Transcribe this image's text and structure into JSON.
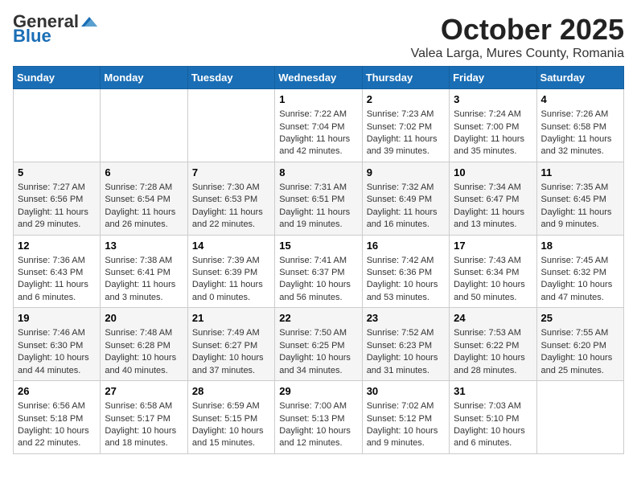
{
  "header": {
    "logo_general": "General",
    "logo_blue": "Blue",
    "month_title": "October 2025",
    "subtitle": "Valea Larga, Mures County, Romania"
  },
  "weekdays": [
    "Sunday",
    "Monday",
    "Tuesday",
    "Wednesday",
    "Thursday",
    "Friday",
    "Saturday"
  ],
  "weeks": [
    [
      {
        "day": "",
        "info": ""
      },
      {
        "day": "",
        "info": ""
      },
      {
        "day": "",
        "info": ""
      },
      {
        "day": "1",
        "info": "Sunrise: 7:22 AM\nSunset: 7:04 PM\nDaylight: 11 hours and 42 minutes."
      },
      {
        "day": "2",
        "info": "Sunrise: 7:23 AM\nSunset: 7:02 PM\nDaylight: 11 hours and 39 minutes."
      },
      {
        "day": "3",
        "info": "Sunrise: 7:24 AM\nSunset: 7:00 PM\nDaylight: 11 hours and 35 minutes."
      },
      {
        "day": "4",
        "info": "Sunrise: 7:26 AM\nSunset: 6:58 PM\nDaylight: 11 hours and 32 minutes."
      }
    ],
    [
      {
        "day": "5",
        "info": "Sunrise: 7:27 AM\nSunset: 6:56 PM\nDaylight: 11 hours and 29 minutes."
      },
      {
        "day": "6",
        "info": "Sunrise: 7:28 AM\nSunset: 6:54 PM\nDaylight: 11 hours and 26 minutes."
      },
      {
        "day": "7",
        "info": "Sunrise: 7:30 AM\nSunset: 6:53 PM\nDaylight: 11 hours and 22 minutes."
      },
      {
        "day": "8",
        "info": "Sunrise: 7:31 AM\nSunset: 6:51 PM\nDaylight: 11 hours and 19 minutes."
      },
      {
        "day": "9",
        "info": "Sunrise: 7:32 AM\nSunset: 6:49 PM\nDaylight: 11 hours and 16 minutes."
      },
      {
        "day": "10",
        "info": "Sunrise: 7:34 AM\nSunset: 6:47 PM\nDaylight: 11 hours and 13 minutes."
      },
      {
        "day": "11",
        "info": "Sunrise: 7:35 AM\nSunset: 6:45 PM\nDaylight: 11 hours and 9 minutes."
      }
    ],
    [
      {
        "day": "12",
        "info": "Sunrise: 7:36 AM\nSunset: 6:43 PM\nDaylight: 11 hours and 6 minutes."
      },
      {
        "day": "13",
        "info": "Sunrise: 7:38 AM\nSunset: 6:41 PM\nDaylight: 11 hours and 3 minutes."
      },
      {
        "day": "14",
        "info": "Sunrise: 7:39 AM\nSunset: 6:39 PM\nDaylight: 11 hours and 0 minutes."
      },
      {
        "day": "15",
        "info": "Sunrise: 7:41 AM\nSunset: 6:37 PM\nDaylight: 10 hours and 56 minutes."
      },
      {
        "day": "16",
        "info": "Sunrise: 7:42 AM\nSunset: 6:36 PM\nDaylight: 10 hours and 53 minutes."
      },
      {
        "day": "17",
        "info": "Sunrise: 7:43 AM\nSunset: 6:34 PM\nDaylight: 10 hours and 50 minutes."
      },
      {
        "day": "18",
        "info": "Sunrise: 7:45 AM\nSunset: 6:32 PM\nDaylight: 10 hours and 47 minutes."
      }
    ],
    [
      {
        "day": "19",
        "info": "Sunrise: 7:46 AM\nSunset: 6:30 PM\nDaylight: 10 hours and 44 minutes."
      },
      {
        "day": "20",
        "info": "Sunrise: 7:48 AM\nSunset: 6:28 PM\nDaylight: 10 hours and 40 minutes."
      },
      {
        "day": "21",
        "info": "Sunrise: 7:49 AM\nSunset: 6:27 PM\nDaylight: 10 hours and 37 minutes."
      },
      {
        "day": "22",
        "info": "Sunrise: 7:50 AM\nSunset: 6:25 PM\nDaylight: 10 hours and 34 minutes."
      },
      {
        "day": "23",
        "info": "Sunrise: 7:52 AM\nSunset: 6:23 PM\nDaylight: 10 hours and 31 minutes."
      },
      {
        "day": "24",
        "info": "Sunrise: 7:53 AM\nSunset: 6:22 PM\nDaylight: 10 hours and 28 minutes."
      },
      {
        "day": "25",
        "info": "Sunrise: 7:55 AM\nSunset: 6:20 PM\nDaylight: 10 hours and 25 minutes."
      }
    ],
    [
      {
        "day": "26",
        "info": "Sunrise: 6:56 AM\nSunset: 5:18 PM\nDaylight: 10 hours and 22 minutes."
      },
      {
        "day": "27",
        "info": "Sunrise: 6:58 AM\nSunset: 5:17 PM\nDaylight: 10 hours and 18 minutes."
      },
      {
        "day": "28",
        "info": "Sunrise: 6:59 AM\nSunset: 5:15 PM\nDaylight: 10 hours and 15 minutes."
      },
      {
        "day": "29",
        "info": "Sunrise: 7:00 AM\nSunset: 5:13 PM\nDaylight: 10 hours and 12 minutes."
      },
      {
        "day": "30",
        "info": "Sunrise: 7:02 AM\nSunset: 5:12 PM\nDaylight: 10 hours and 9 minutes."
      },
      {
        "day": "31",
        "info": "Sunrise: 7:03 AM\nSunset: 5:10 PM\nDaylight: 10 hours and 6 minutes."
      },
      {
        "day": "",
        "info": ""
      }
    ]
  ]
}
